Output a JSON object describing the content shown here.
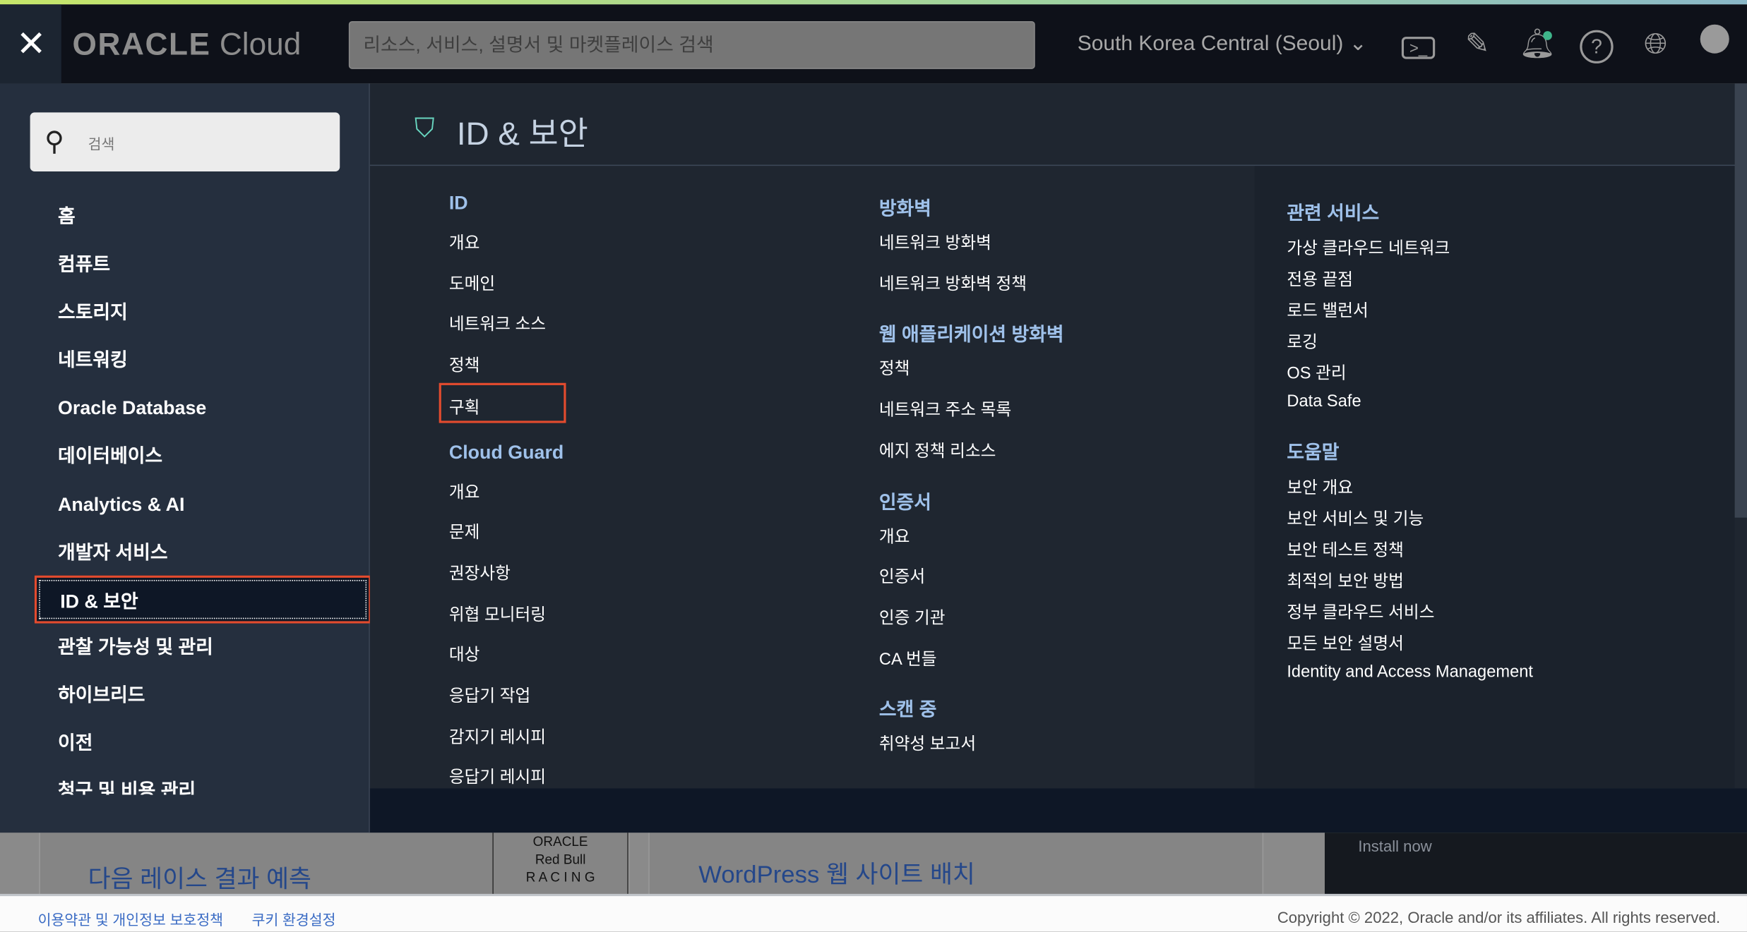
{
  "header": {
    "close_icon": "close-icon",
    "logo": "ORACLE Cloud",
    "logo_brand": "ORACLE",
    "logo_product": "Cloud",
    "search_placeholder": "리소스, 서비스, 설명서 및 마켓플레이스 검색",
    "region": "South Korea Central (Seoul)",
    "icons": [
      "cloud-shell-icon",
      "edit-icon",
      "bell-icon",
      "help-icon",
      "globe-icon",
      "user-icon"
    ]
  },
  "sidebar": {
    "search_placeholder": "검색",
    "items": [
      {
        "label": "홈"
      },
      {
        "label": "컴퓨트"
      },
      {
        "label": "스토리지"
      },
      {
        "label": "네트워킹"
      },
      {
        "label": "Oracle Database"
      },
      {
        "label": "데이터베이스"
      },
      {
        "label": "Analytics & AI"
      },
      {
        "label": "개발자 서비스"
      },
      {
        "label": "ID & 보안",
        "selected": true
      },
      {
        "label": "관찰 가능성 및 관리"
      },
      {
        "label": "하이브리드"
      },
      {
        "label": "이전"
      },
      {
        "label": "청구 및 비용 관리"
      }
    ]
  },
  "main": {
    "title": "ID & 보안",
    "col1": [
      {
        "group": "ID",
        "items": [
          "개요",
          "도메인",
          "네트워크 소스",
          "정책",
          "구획"
        ]
      },
      {
        "group": "Cloud Guard",
        "items": [
          "개요",
          "문제",
          "권장사항",
          "위협 모니터링",
          "대상",
          "응답기 작업",
          "감지기 레시피",
          "응답기 레시피"
        ]
      }
    ],
    "col2": [
      {
        "group": "방화벽",
        "items": [
          "네트워크 방화벽",
          "네트워크 방화벽 정책"
        ]
      },
      {
        "group": "웹 애플리케이션 방화벽",
        "items": [
          "정책",
          "네트워크 주소 목록",
          "에지 정책 리소스"
        ]
      },
      {
        "group": "인증서",
        "items": [
          "개요",
          "인증서",
          "인증 기관",
          "CA 번들"
        ]
      },
      {
        "group": "스캔 중",
        "items": [
          "취약성 보고서"
        ]
      }
    ],
    "col3": [
      {
        "group": "관련 서비스",
        "items": [
          "가상 클라우드 네트워크",
          "전용 끝점",
          "로드 밸런서",
          "로깅",
          "OS 관리",
          "Data Safe"
        ]
      },
      {
        "group": "도움말",
        "items": [
          "보안 개요",
          "보안 서비스 및 기능",
          "보안 테스트 정책",
          "최적의 보안 방법",
          "정부 클라우드 서비스",
          "모든 보안 설명서",
          "Identity and Access Management"
        ]
      }
    ]
  },
  "background": {
    "card1_title": "다음 레이스 결과 예측",
    "card1_logo": "ORACLE Red Bull RACING",
    "card2_title": "WordPress 웹 사이트 배치",
    "install": "Install now"
  },
  "footer": {
    "terms": "이용약관 및 개인정보 보호정책",
    "cookies": "쿠키 환경설정",
    "copyright": "Copyright © 2022, Oracle and/or its affiliates. All rights reserved."
  },
  "colors": {
    "highlight": "#e34b2e",
    "group_heading": "#9fc1ea",
    "shield": "#68d6c0"
  }
}
